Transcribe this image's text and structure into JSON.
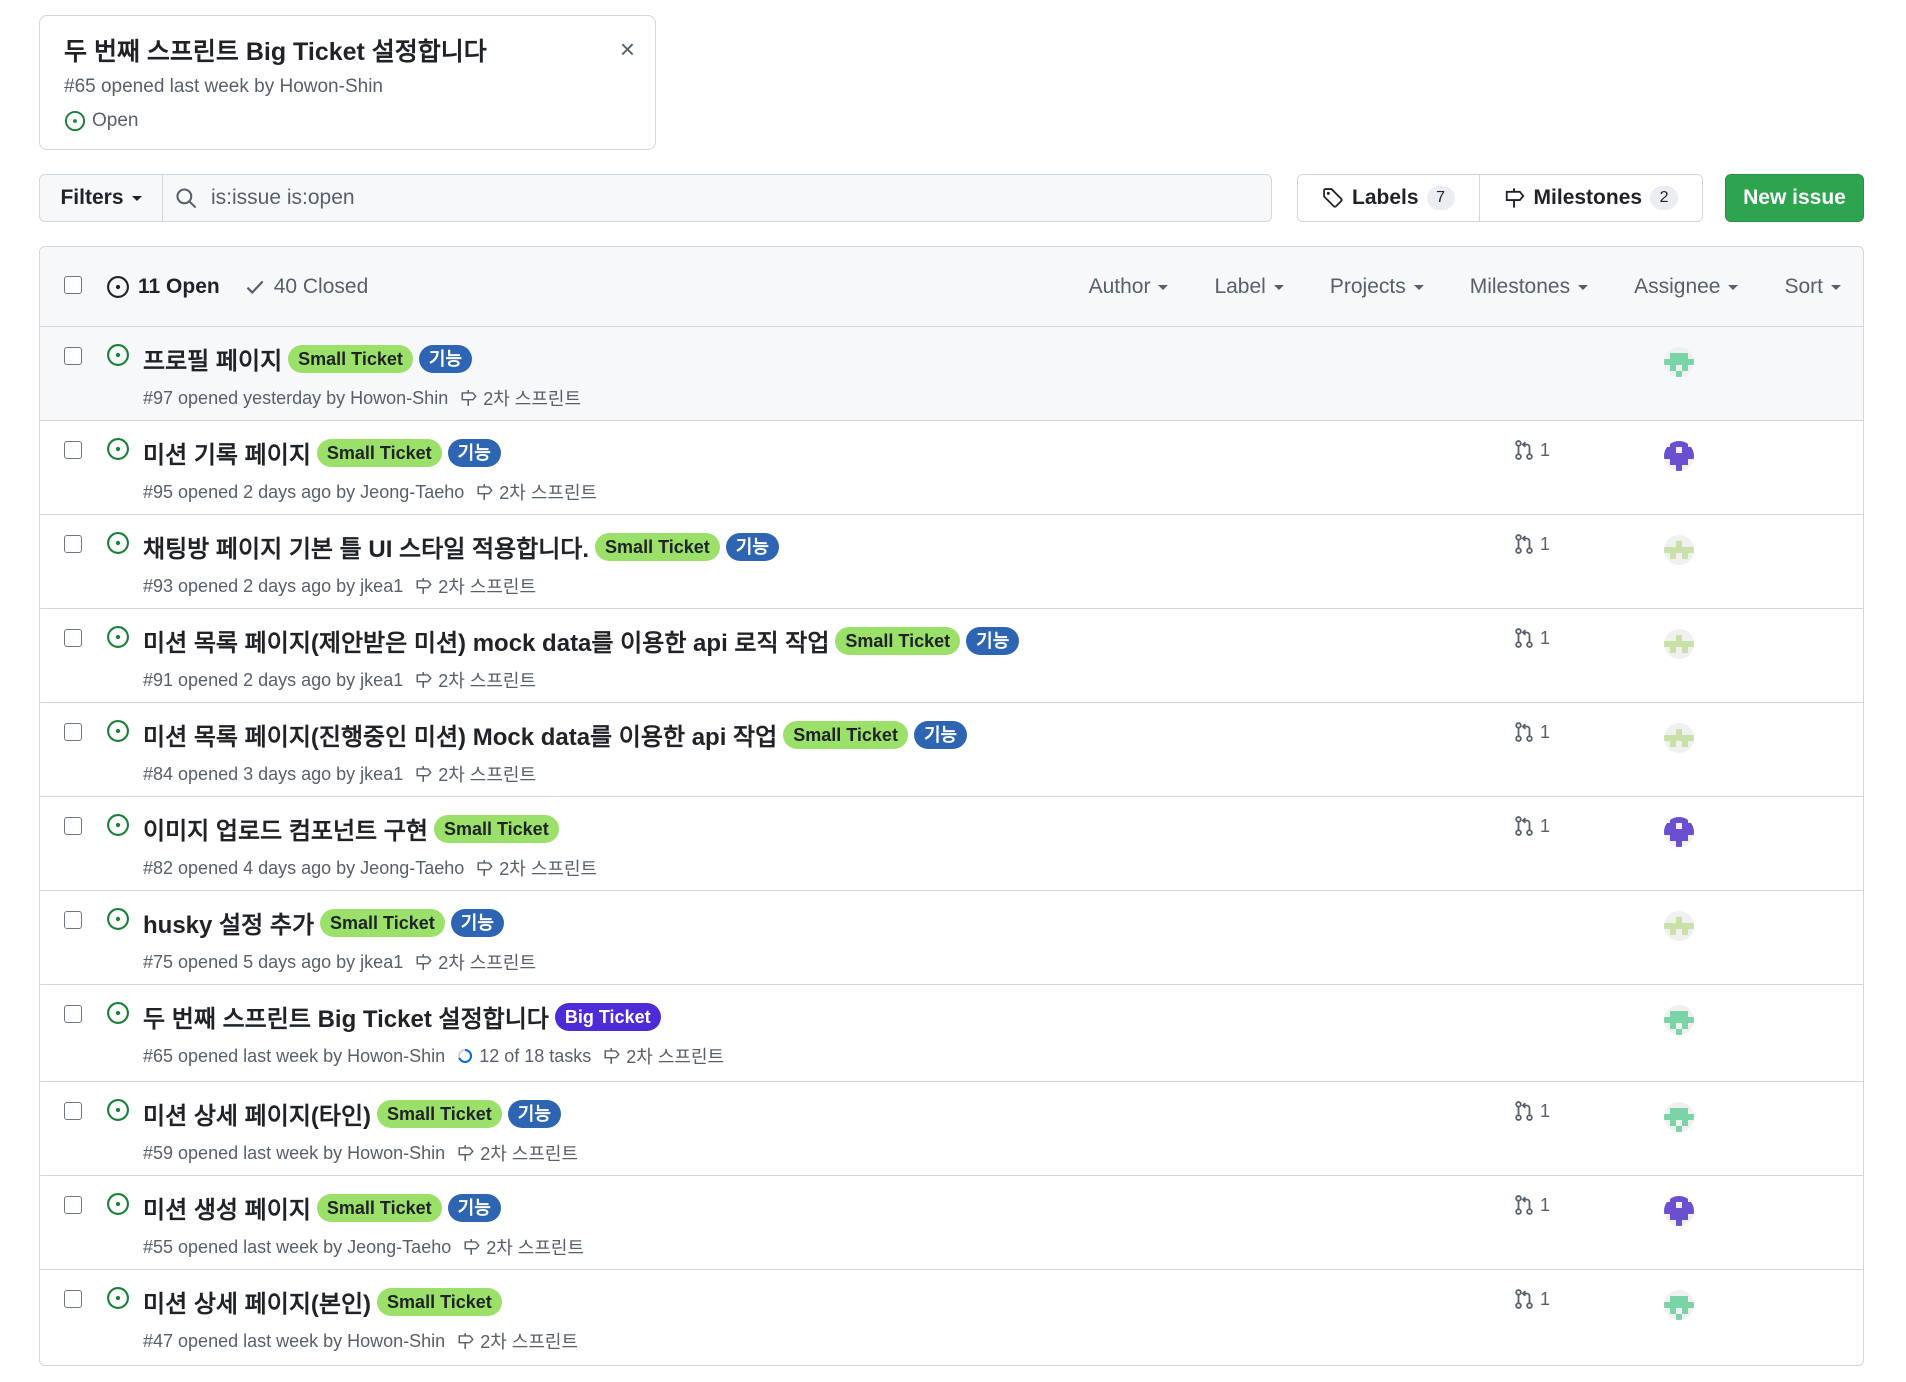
{
  "popover": {
    "title": "두 번째 스프린트 Big Ticket 설정합니다",
    "meta": "#65 opened last week by Howon-Shin",
    "state": "Open",
    "close_glyph": "×"
  },
  "toolbar": {
    "filters_label": "Filters",
    "search_value": "is:issue is:open",
    "labels_label": "Labels",
    "labels_count": "7",
    "milestones_label": "Milestones",
    "milestones_count": "2",
    "new_issue_label": "New issue"
  },
  "list_header": {
    "open_label": "11 Open",
    "closed_label": "40 Closed",
    "filters": [
      "Author",
      "Label",
      "Projects",
      "Milestones",
      "Assignee",
      "Sort"
    ]
  },
  "colors": {
    "open_green": "#1a7f37",
    "small_ticket": "#9be069",
    "feature": "#2e65b2",
    "big_ticket": "#4d2bd6",
    "primary_button": "#2da44e"
  },
  "issues": [
    {
      "title": "프로필 페이지",
      "labels": [
        "Small Ticket",
        "기능"
      ],
      "meta": "#97 opened yesterday by Howon-Shin",
      "milestone": "2차 스프린트",
      "pr_count": "",
      "avatar": "howon"
    },
    {
      "title": "미션 기록 페이지",
      "labels": [
        "Small Ticket",
        "기능"
      ],
      "meta": "#95 opened 2 days ago by Jeong-Taeho",
      "milestone": "2차 스프린트",
      "pr_count": "1",
      "avatar": "jeong"
    },
    {
      "title": "채팅방 페이지 기본 틀 UI 스타일 적용합니다.",
      "labels": [
        "Small Ticket",
        "기능"
      ],
      "meta": "#93 opened 2 days ago by jkea1",
      "milestone": "2차 스프린트",
      "pr_count": "1",
      "avatar": "jkea"
    },
    {
      "title": "미션 목록 페이지(제안받은 미션) mock data를 이용한 api 로직 작업",
      "labels": [
        "Small Ticket",
        "기능"
      ],
      "meta": "#91 opened 2 days ago by jkea1",
      "milestone": "2차 스프린트",
      "pr_count": "1",
      "avatar": "jkea"
    },
    {
      "title": "미션 목록 페이지(진행중인 미션) Mock data를 이용한 api 작업",
      "labels": [
        "Small Ticket",
        "기능"
      ],
      "meta": "#84 opened 3 days ago by jkea1",
      "milestone": "2차 스프린트",
      "pr_count": "1",
      "avatar": "jkea"
    },
    {
      "title": "이미지 업로드 컴포넌트 구현",
      "labels": [
        "Small Ticket"
      ],
      "meta": "#82 opened 4 days ago by Jeong-Taeho",
      "milestone": "2차 스프린트",
      "pr_count": "1",
      "avatar": "jeong"
    },
    {
      "title": "husky 설정 추가",
      "labels": [
        "Small Ticket",
        "기능"
      ],
      "meta": "#75 opened 5 days ago by jkea1",
      "milestone": "2차 스프린트",
      "pr_count": "",
      "avatar": "jkea"
    },
    {
      "title": "두 번째 스프린트 Big Ticket 설정합니다",
      "labels": [
        "Big Ticket"
      ],
      "meta": "#65 opened last week by Howon-Shin",
      "tasks": "12 of 18 tasks",
      "milestone": "2차 스프린트",
      "pr_count": "",
      "avatar": "howon"
    },
    {
      "title": "미션 상세 페이지(타인)",
      "labels": [
        "Small Ticket",
        "기능"
      ],
      "meta": "#59 opened last week by Howon-Shin",
      "milestone": "2차 스프린트",
      "pr_count": "1",
      "avatar": "howon"
    },
    {
      "title": "미션 생성 페이지",
      "labels": [
        "Small Ticket",
        "기능"
      ],
      "meta": "#55 opened last week by Jeong-Taeho",
      "milestone": "2차 스프린트",
      "pr_count": "1",
      "avatar": "jeong"
    },
    {
      "title": "미션 상세 페이지(본인)",
      "labels": [
        "Small Ticket"
      ],
      "meta": "#47 opened last week by Howon-Shin",
      "milestone": "2차 스프린트",
      "pr_count": "1",
      "avatar": "howon"
    }
  ]
}
